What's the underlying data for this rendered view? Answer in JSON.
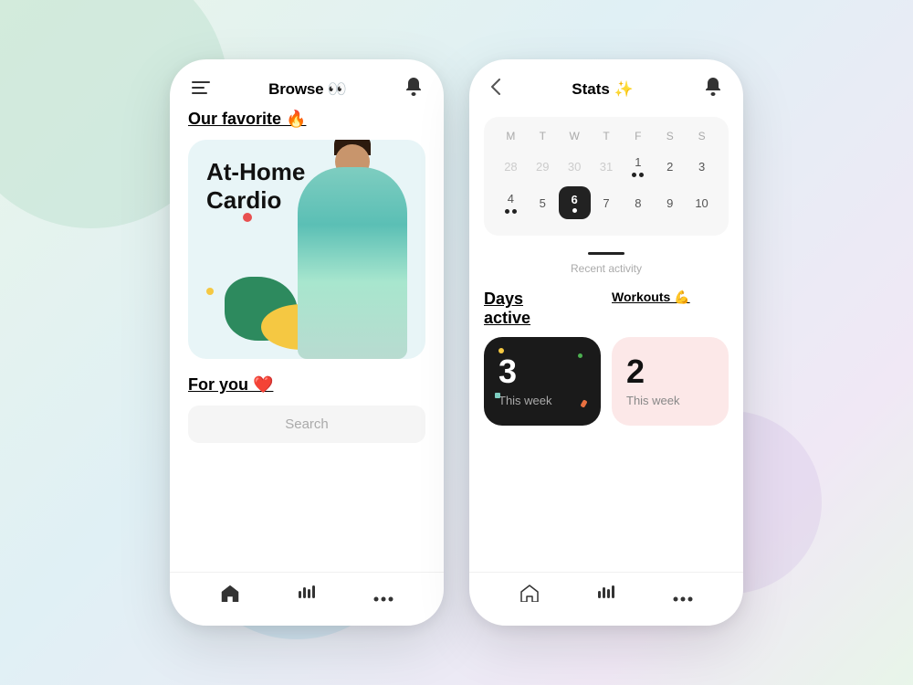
{
  "background": {
    "colors": [
      "#e8f5e9",
      "#e0f0f5",
      "#f0e8f5"
    ]
  },
  "phone1": {
    "header": {
      "title": "Browse 👀",
      "menu_icon": "☰",
      "bell_icon": "🔔"
    },
    "featured_section": {
      "label": "Our favorite 🔥",
      "card_title": "At-Home\nCardio"
    },
    "for_you_section": {
      "label": "For you ❤️"
    },
    "search": {
      "placeholder": "Search"
    },
    "nav": {
      "home_icon": "⌂",
      "activity_icon": "|||",
      "more_icon": "⋯"
    }
  },
  "phone2": {
    "header": {
      "back_icon": "<",
      "title": "Stats ✨",
      "bell_icon": "🔔"
    },
    "calendar": {
      "day_headers": [
        "M",
        "T",
        "W",
        "T",
        "F",
        "S",
        "S"
      ],
      "week1": [
        "28",
        "29",
        "30",
        "31",
        "1",
        "2",
        "3"
      ],
      "week2": [
        "4",
        "5",
        "6",
        "7",
        "8",
        "9",
        "10"
      ],
      "active_day": "6",
      "dots_week1": [
        false,
        false,
        false,
        false,
        true,
        false,
        false
      ],
      "dots_week2": [
        true,
        false,
        true,
        false,
        false,
        false,
        false
      ]
    },
    "recent_activity": {
      "label": "Recent activity"
    },
    "days_active": {
      "title": "Days\nactive",
      "card": {
        "number": "3",
        "label": "This week"
      }
    },
    "workouts": {
      "title": "Workouts 💪",
      "card": {
        "number": "2",
        "label": "This week"
      }
    },
    "nav": {
      "home_icon": "⌂",
      "activity_icon": "|||",
      "more_icon": "⋯"
    }
  }
}
